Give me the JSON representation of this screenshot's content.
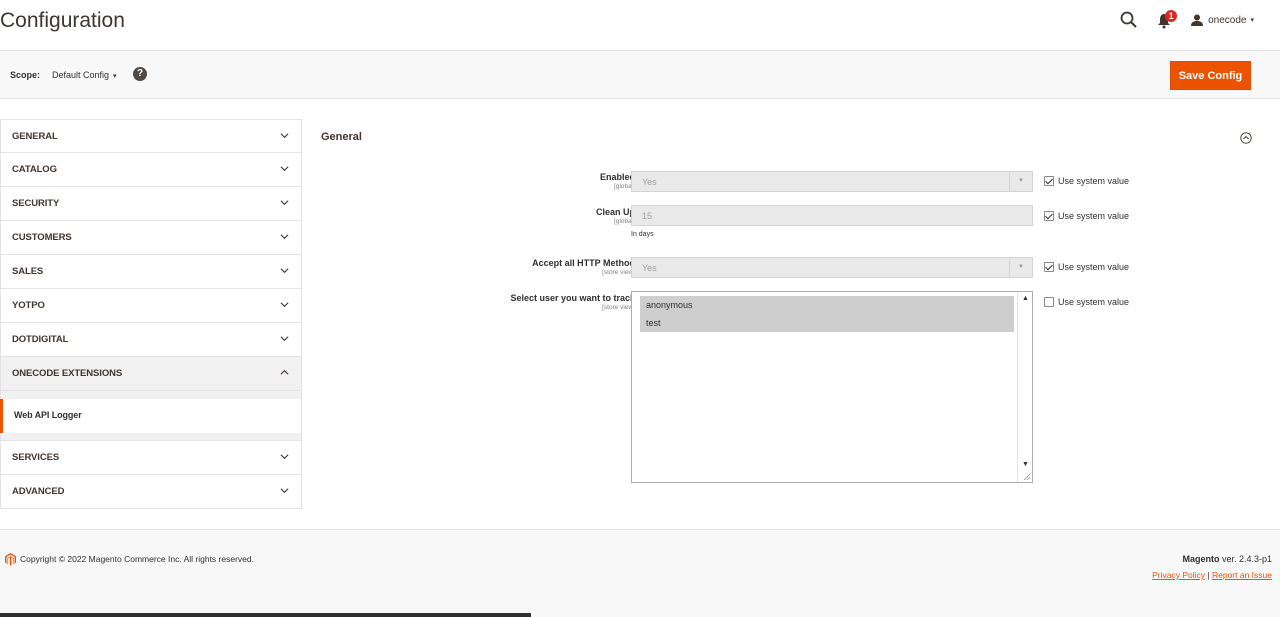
{
  "header": {
    "title": "Configuration",
    "notification_count": "1",
    "user_name": "onecode",
    "user_caret": "▾"
  },
  "scope": {
    "label": "Scope:",
    "value": "Default Config",
    "caret": "▾",
    "help": "?"
  },
  "toolbar": {
    "save_label": "Save Config"
  },
  "sidebar": {
    "items": [
      {
        "label": "GENERAL"
      },
      {
        "label": "CATALOG"
      },
      {
        "label": "SECURITY"
      },
      {
        "label": "CUSTOMERS"
      },
      {
        "label": "SALES"
      },
      {
        "label": "YOTPO"
      },
      {
        "label": "DOTDIGITAL"
      },
      {
        "label": "ONECODE EXTENSIONS",
        "open": true
      },
      {
        "label": "SERVICES"
      },
      {
        "label": "ADVANCED"
      }
    ],
    "sub_items": [
      {
        "label": "Web API Logger",
        "active": true
      }
    ]
  },
  "main": {
    "section_title": "General",
    "fields": {
      "enabled": {
        "label": "Enabled",
        "scope": "[global]",
        "value": "Yes",
        "use_system": "Use system value",
        "use_system_checked": true
      },
      "cleanup": {
        "label": "Clean Up",
        "scope": "[global]",
        "value": "15",
        "note": "In days",
        "use_system": "Use system value",
        "use_system_checked": true
      },
      "accept_http": {
        "label": "Accept all HTTP Method",
        "scope": "[store view]",
        "value": "Yes",
        "use_system": "Use system value",
        "use_system_checked": true
      },
      "track_users": {
        "label": "Select user you want to track",
        "scope": "[store view]",
        "options": [
          "anonymous",
          "test"
        ],
        "use_system": "Use system value",
        "use_system_checked": false
      }
    }
  },
  "footer": {
    "copyright": "Copyright © 2022 Magento Commerce Inc. All rights reserved.",
    "brand": "Magento",
    "version": " ver. 2.4.3-p1",
    "privacy": "Privacy Policy",
    "separator": " | ",
    "report": "Report an Issue"
  },
  "colors": {
    "accent": "#eb5202",
    "badge": "#e22626",
    "text": "#303030"
  }
}
